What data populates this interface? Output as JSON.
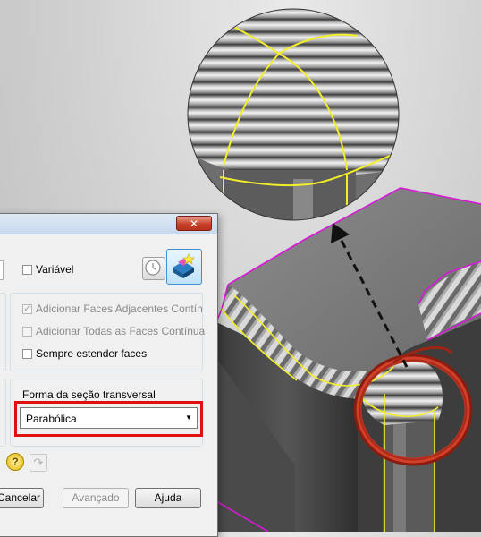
{
  "dialog": {
    "close_glyph": "✕",
    "variable_label": "Variável",
    "faces": {
      "add_adjacent": "Adicionar Faces Adjacentes Contín",
      "add_all": "Adicionar Todas as Faces Contínua",
      "always_extend": "Sempre estender faces"
    },
    "cross_section_label": "Forma da seção transversal",
    "cross_section_value": "Parabólica",
    "help_glyph": "?",
    "undo_glyph": "↷",
    "buttons": {
      "cancel": "Cancelar",
      "advanced": "Avançado",
      "help": "Ajuda"
    }
  },
  "colors": {
    "highlight": "#e01010",
    "edge_yellow": "#f2ee2a",
    "edge_magenta": "#d61ad6",
    "callout_ring": "#d2402a"
  },
  "icons": [
    "clock-icon",
    "fillet-preview-icon",
    "help-icon",
    "undo-icon",
    "close-icon",
    "dropdown-arrow-icon"
  ]
}
